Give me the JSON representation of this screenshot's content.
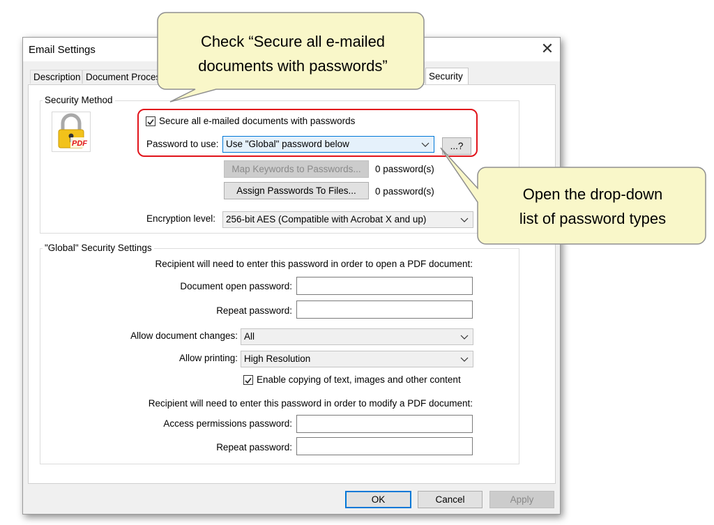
{
  "dialog": {
    "title": "Email Settings",
    "close_glyph": "✕"
  },
  "tabs": {
    "description": "Description",
    "document_processing": "Document Processi",
    "security": "Security"
  },
  "security_method": {
    "legend": "Security Method",
    "icon": "lock-pdf-icon",
    "secure_checkbox_label": "Secure all e-mailed documents with passwords",
    "secure_checked": true,
    "password_to_use_label": "Password to use:",
    "password_to_use_value": "Use \"Global\" password below",
    "ellipsis_button": "...?",
    "map_keywords_button": "Map Keywords to Passwords...",
    "map_keywords_count": "0 password(s)",
    "assign_passwords_button": "Assign Passwords To Files...",
    "assign_passwords_count": "0 password(s)",
    "encryption_label": "Encryption level:",
    "encryption_value": "256-bit AES (Compatible with Acrobat X and up)"
  },
  "global": {
    "legend": "\"Global\" Security Settings",
    "open_note": "Recipient will need to enter this password  in order to open a PDF document:",
    "doc_open_password_label": "Document open password:",
    "repeat_password_label": "Repeat password:",
    "allow_changes_label": "Allow document changes:",
    "allow_changes_value": "All",
    "allow_printing_label": "Allow printing:",
    "allow_printing_value": "High Resolution",
    "enable_copying_label": "Enable copying of text, images and other content",
    "enable_copying_checked": true,
    "modify_note": "Recipient will need to enter this password in order to modify a PDF document:",
    "access_permissions_label": "Access permissions password:",
    "repeat_password_label_2": "Repeat password:"
  },
  "buttons": {
    "ok": "OK",
    "cancel": "Cancel",
    "apply": "Apply"
  },
  "callouts": {
    "top_line1": "Check “Secure all e-mailed",
    "top_line2": "documents with passwords”",
    "right_line1": "Open the drop-down",
    "right_line2": "list of password types"
  },
  "colors": {
    "callout_fill": "#f9f7c9",
    "highlight_border": "#e1141b",
    "selected_combo": "#e5f1fb",
    "accent": "#0078d7"
  }
}
